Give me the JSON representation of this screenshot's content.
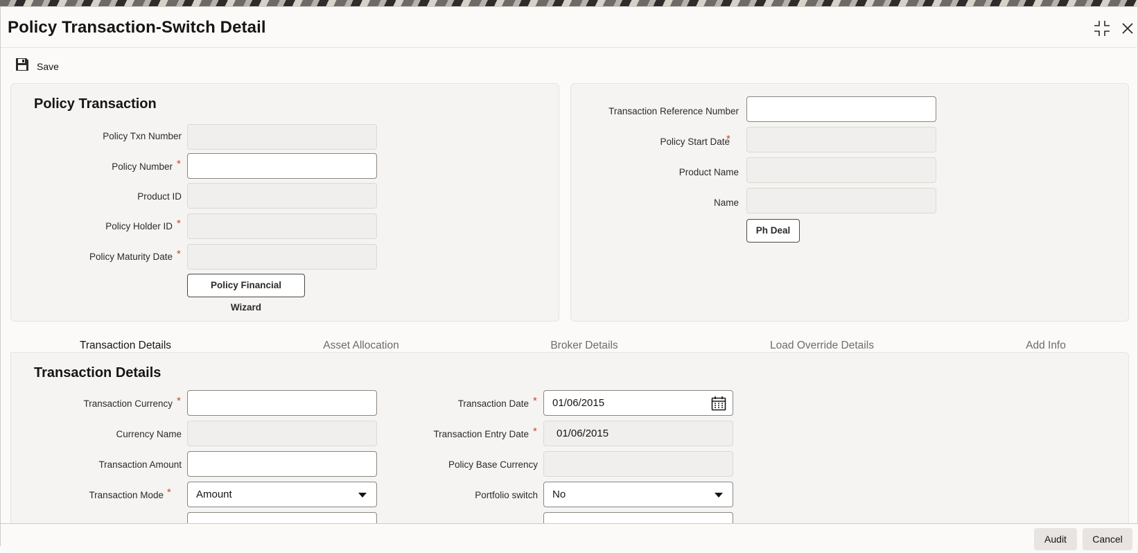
{
  "window": {
    "title": "Policy Transaction-Switch Detail"
  },
  "toolbar": {
    "save_label": "Save"
  },
  "policy_panel": {
    "title": "Policy Transaction",
    "txn_number_label": "Policy Txn Number",
    "txn_number_value": "",
    "policy_number_label": "Policy Number",
    "policy_number_value": "",
    "product_id_label": "Product ID",
    "product_id_value": "",
    "holder_id_label": "Policy Holder ID",
    "holder_id_value": "",
    "maturity_label": "Policy Maturity Date",
    "maturity_value": "",
    "wizard_button": "Policy Financial Wizard"
  },
  "right_panel": {
    "ref_label": "Transaction Reference Number",
    "ref_value": "",
    "start_label": "Policy Start Date",
    "start_value": "",
    "product_name_label": "Product Name",
    "product_name_value": "",
    "name_label": "Name",
    "name_value": "",
    "ph_deal_button": "Ph Deal"
  },
  "tabs": [
    {
      "label": "Transaction Details",
      "active": true
    },
    {
      "label": "Asset Allocation",
      "active": false
    },
    {
      "label": "Broker Details",
      "active": false
    },
    {
      "label": "Load Override Details",
      "active": false
    },
    {
      "label": "Add Info",
      "active": false
    }
  ],
  "txn_details": {
    "title": "Transaction Details",
    "currency_label": "Transaction Currency",
    "currency_value": "",
    "currency_name_label": "Currency Name",
    "currency_name_value": "",
    "amount_label": "Transaction Amount",
    "amount_value": "",
    "mode_label": "Transaction Mode",
    "mode_value": "Amount",
    "date_label": "Transaction Date",
    "date_value": "01/06/2015",
    "entry_date_label": "Transaction Entry Date",
    "entry_date_value": "01/06/2015",
    "base_currency_label": "Policy Base Currency",
    "base_currency_value": "",
    "portfolio_label": "Portfolio switch",
    "portfolio_value": "No"
  },
  "required_marker": "*",
  "footer": {
    "audit_label": "Audit",
    "cancel_label": "Cancel"
  },
  "colors": {
    "required": "#c74634",
    "tab_underline": "#3e5a78"
  },
  "icons": [
    "maximize-icon",
    "close-icon",
    "save-icon",
    "search-icon",
    "calendar-icon",
    "chevron-down-icon"
  ]
}
